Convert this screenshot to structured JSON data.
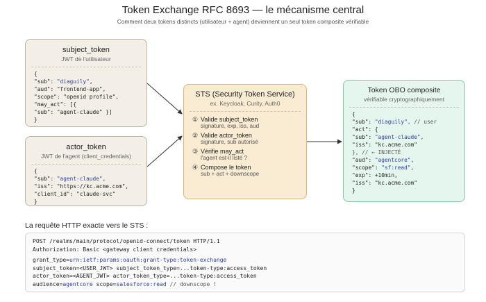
{
  "header": {
    "title": "Token Exchange RFC 8693 — le mécanisme central",
    "subtitle": "Comment deux tokens distincts (utilisateur + agent) deviennent un seul token composite vérifiable"
  },
  "subject_token": {
    "title": "subject_token",
    "subtitle": "JWT de l'utilisateur",
    "lines": [
      [
        {
          "t": "{"
        }
      ],
      [
        {
          "t": "\"sub\": "
        },
        {
          "t": "\"diaguily\"",
          "s": 1
        },
        {
          "t": ","
        }
      ],
      [
        {
          "t": "\"aud\": \"frontend-app\","
        }
      ],
      [
        {
          "t": "\"scope\": \"openid profile\","
        }
      ],
      [
        {
          "t": "\"may_act\": [{"
        }
      ],
      [
        {
          "t": "\"sub\": \"agent-claude\" }]"
        }
      ],
      [
        {
          "t": "}"
        }
      ]
    ]
  },
  "actor_token": {
    "title": "actor_token",
    "subtitle": "JWT de l'agent (client_credentials)",
    "lines": [
      [
        {
          "t": "{"
        }
      ],
      [
        {
          "t": "\"sub\": "
        },
        {
          "t": "\"agent-claude\"",
          "s": 1
        },
        {
          "t": ","
        }
      ],
      [
        {
          "t": "\"iss\": \"https://kc.acme.com\","
        }
      ],
      [
        {
          "t": "\"client_id\": \"claude-svc\""
        }
      ],
      [
        {
          "t": "}"
        }
      ]
    ]
  },
  "sts": {
    "title": "STS (Security Token Service)",
    "subtitle": "ex. Keycloak, Curity, Auth0",
    "steps": [
      {
        "num": "①",
        "label": "Valide subject_token",
        "detail": "signature, exp, iss, aud"
      },
      {
        "num": "②",
        "label": "Valide actor_token",
        "detail": "signature, sub autorisé"
      },
      {
        "num": "③",
        "label": "Vérifie may_act",
        "detail": "l'agent est-il listé ?"
      },
      {
        "num": "④",
        "label": "Compose le token",
        "detail": "sub + act + downscope"
      }
    ]
  },
  "obo_token": {
    "title": "Token OBO composite",
    "subtitle": "vérifiable cryptographiquement",
    "lines": [
      [
        {
          "t": "{"
        }
      ],
      [
        {
          "t": "\"sub\": "
        },
        {
          "t": "\"diaguily\"",
          "s": 1
        },
        {
          "t": ", // user",
          "c": 1
        }
      ],
      [
        {
          "t": "\"act\": {"
        }
      ],
      [
        {
          "t": "\"sub\": "
        },
        {
          "t": "\"agent-claude\"",
          "s": 1
        },
        {
          "t": ","
        }
      ],
      [
        {
          "t": "\"iss\": \"kc.acme.com\""
        }
      ],
      [
        {
          "t": "}, // ← INJECTÉ",
          "c": 1
        }
      ],
      [
        {
          "t": "\"aud\": "
        },
        {
          "t": "\"agentcore\"",
          "s": 1
        },
        {
          "t": ","
        }
      ],
      [
        {
          "t": "\"scope\": "
        },
        {
          "t": "\"sf:read\"",
          "s": 1
        },
        {
          "t": ","
        }
      ],
      [
        {
          "t": "\"exp\": +10min,"
        }
      ],
      [
        {
          "t": "\"iss\": \"kc.acme.com\""
        }
      ],
      [
        {
          "t": "}"
        }
      ]
    ]
  },
  "request": {
    "heading": "La requête HTTP exacte vers le STS :",
    "lines": [
      [
        {
          "t": "POST /realms/main/protocol/openid-connect/token HTTP/1.1"
        }
      ],
      [
        {
          "t": "Authorization: Basic <gateway client credentials>"
        }
      ],
      [],
      [
        {
          "t": "grant_type="
        },
        {
          "t": "urn:ietf:params:oauth:grant-type:token-exchange",
          "s": 1
        }
      ],
      [
        {
          "t": "subject_token=<USER_JWT> subject_token_type=...token-type:access_token"
        }
      ],
      [
        {
          "t": "actor_token=<AGENT_JWT> actor_token_type=...token-type:access_token"
        }
      ],
      [
        {
          "t": "audience="
        },
        {
          "t": "agentcore",
          "s": 1
        },
        {
          "t": " scope="
        },
        {
          "t": "salesforce:read",
          "s": 1
        },
        {
          "t": " // downscope !",
          "c": 1
        }
      ]
    ]
  },
  "colors": {
    "input_box": "#f3efe7",
    "sts_box": "#faebd3",
    "obo_box": "#e5f6ee",
    "string_accent": "#2b3fa6"
  }
}
